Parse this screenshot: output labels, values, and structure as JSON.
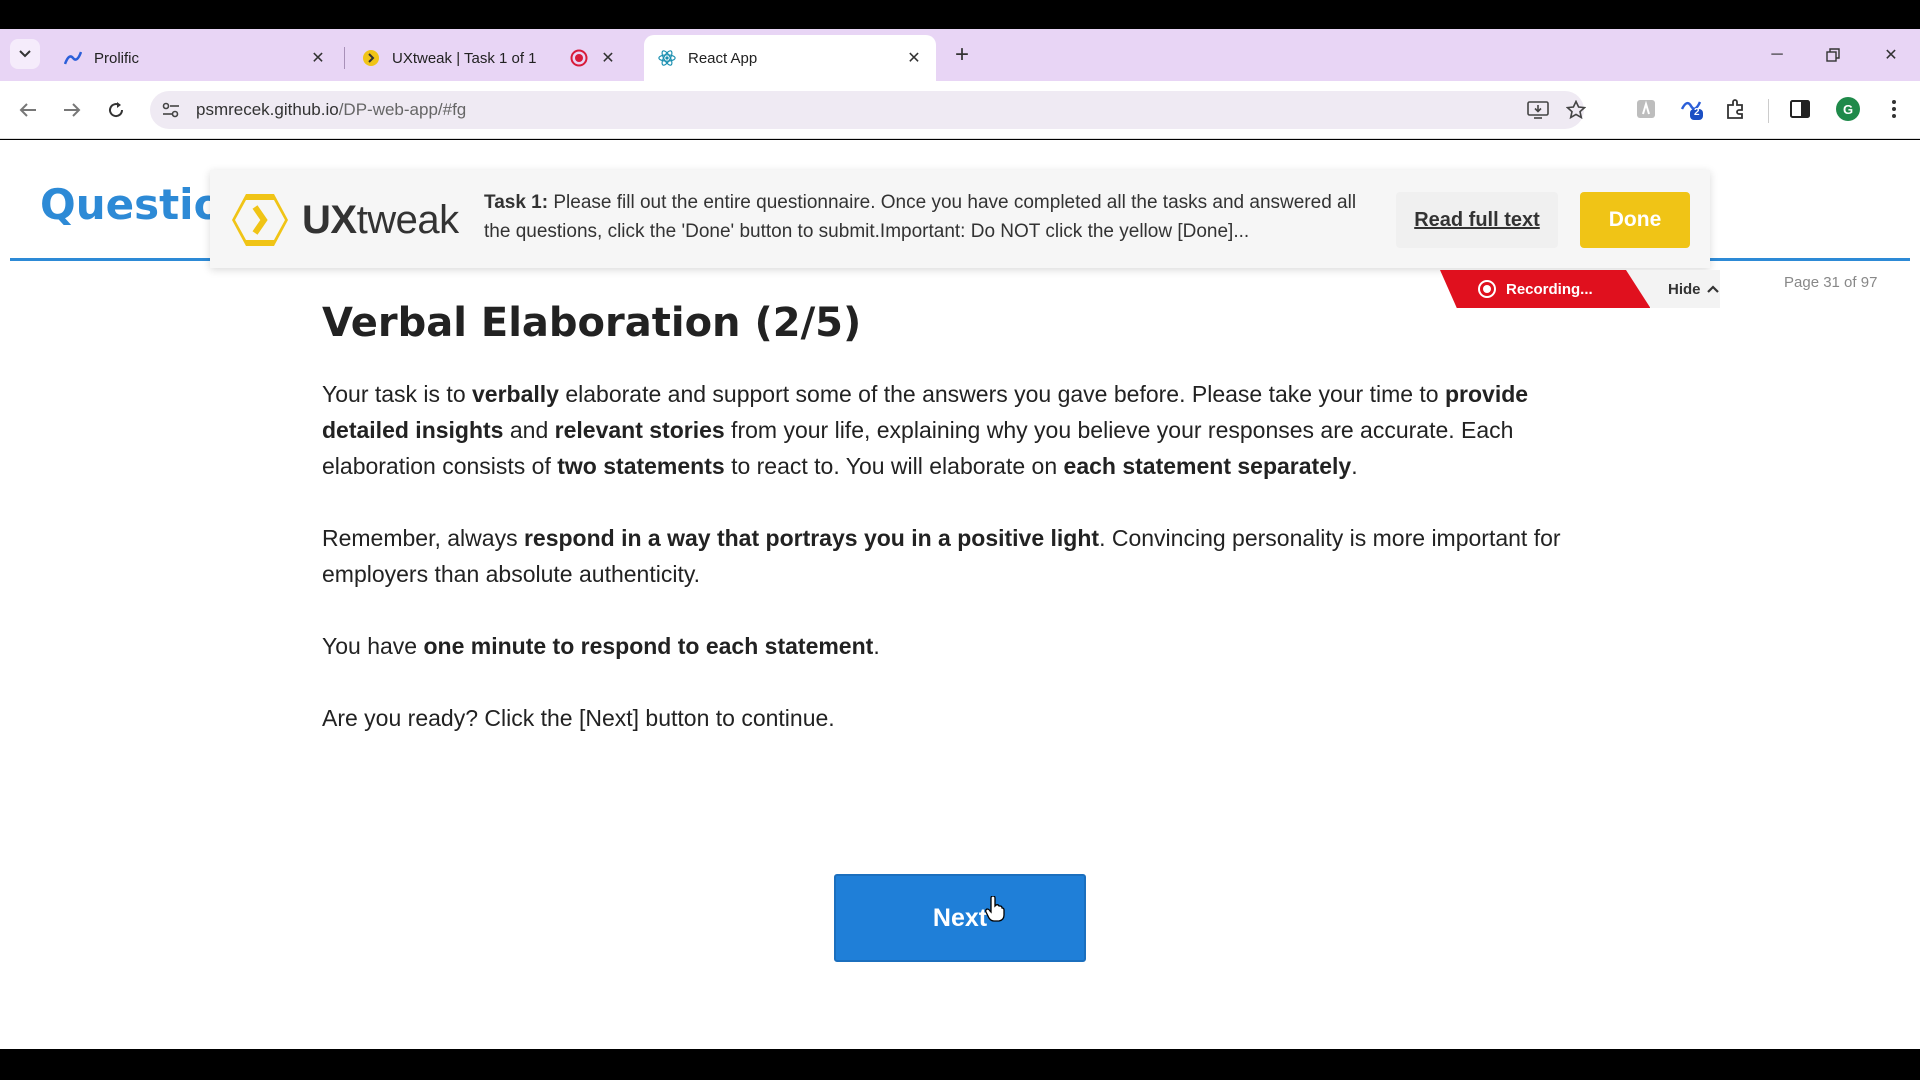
{
  "browser": {
    "tabs": [
      {
        "title": "Prolific",
        "active": false
      },
      {
        "title": "UXtweak | Task 1 of 1",
        "active": false
      },
      {
        "title": "React App",
        "active": true
      }
    ],
    "url_host": "psmrecek.github.io",
    "url_path": "/DP-web-app/#fg",
    "extension_badge": "2",
    "profile_initial": "G"
  },
  "page": {
    "header_title": "Question",
    "page_counter": "Page 31 of 97"
  },
  "uxtweak": {
    "logo_text_bold": "UX",
    "logo_text_rest": "tweak",
    "task_label": "Task 1:",
    "task_text": " Please fill out the entire questionnaire. Once you have completed all the tasks and answered all the questions, click the 'Done' button to submit.Important: Do NOT click the yellow [Done]...",
    "read_full_label": "Read full text",
    "done_label": "Done",
    "recording_label": "Recording...",
    "hide_label": "Hide"
  },
  "content": {
    "heading": "Verbal Elaboration (2/5)",
    "p1": {
      "a": "Your task is to ",
      "b": "verbally",
      "c": " elaborate and support some of the answers you gave before. Please take your time to ",
      "d": "provide detailed insights",
      "e": " and ",
      "f": "relevant stories",
      "g": " from your life, explaining why you believe your responses are accurate. Each elaboration consists of ",
      "h": "two statements",
      "i": " to react to. You will elaborate on ",
      "j": "each statement separately",
      "k": "."
    },
    "p2": {
      "a": "Remember, always ",
      "b": "respond in a way that portrays you in a positive light",
      "c": ". Convincing personality is more important for employers than absolute authenticity."
    },
    "p3": {
      "a": "You have ",
      "b": "one minute to respond to each statement",
      "c": "."
    },
    "p4": "Are you ready? Click the [Next] button to continue.",
    "next_label": "Next"
  },
  "colors": {
    "accent_blue": "#2d8ad6",
    "done_yellow": "#f0c416",
    "recording_red": "#e0101e",
    "tabbar_bg": "#e8d5f5"
  }
}
